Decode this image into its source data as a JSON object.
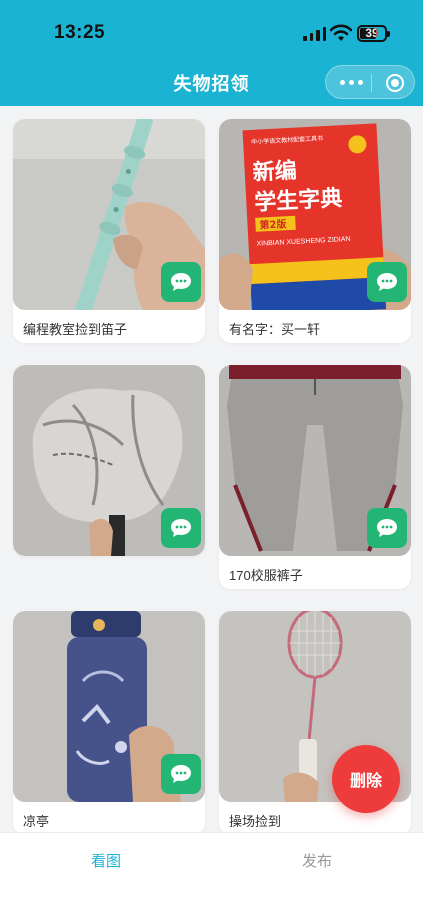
{
  "status_bar": {
    "time": "13:25",
    "battery_level": "39"
  },
  "nav": {
    "title": "失物招领"
  },
  "items": [
    {
      "caption": "编程教室捡到笛子",
      "photo": "recorder-flute"
    },
    {
      "caption": "有名字：买一轩",
      "photo": "dictionary-book"
    },
    {
      "caption": "",
      "photo": "umbrella"
    },
    {
      "caption": "170校服裤子",
      "photo": "uniform-pants"
    },
    {
      "caption": "凉亭",
      "photo": "water-bottle"
    },
    {
      "caption": "操场捡到",
      "photo": "badminton-racket"
    }
  ],
  "book": {
    "series": "中小学语文教材配套工具书",
    "title_line1": "新编",
    "title_line2": "学生字典",
    "edition": "第2版",
    "pinyin": "XINBIAN XUESHENG ZIDIAN"
  },
  "fab": {
    "delete_label": "删除"
  },
  "tabbar": {
    "look_label": "看图",
    "post_label": "发布"
  },
  "colors": {
    "header": "#1bb3d3",
    "chat_button": "#22b573",
    "delete_button": "#ee3b3b",
    "active_tab": "#1bb3d3"
  }
}
